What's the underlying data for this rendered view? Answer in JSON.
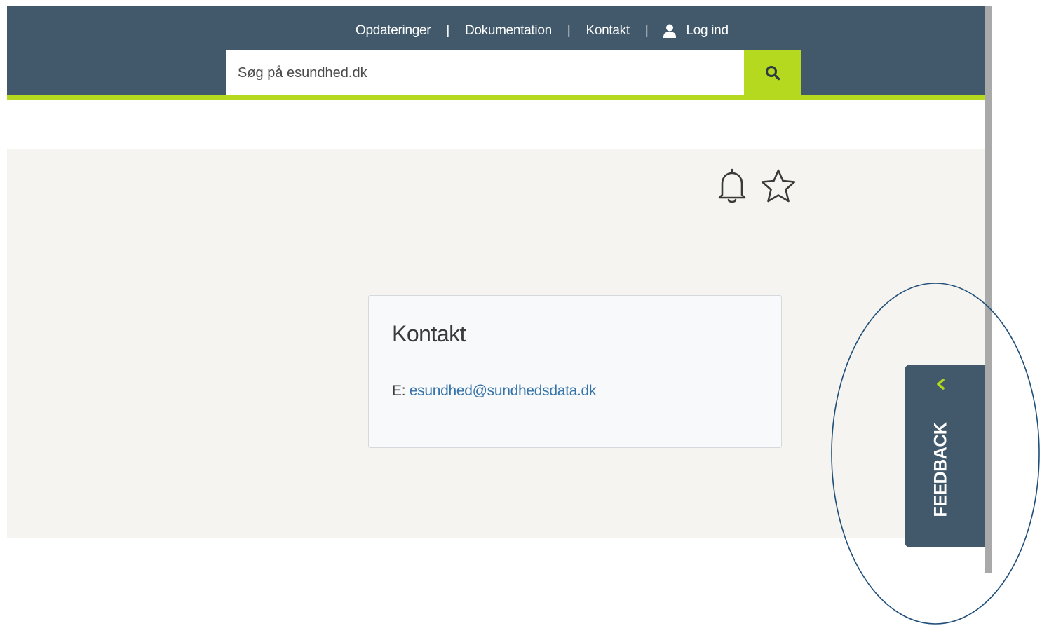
{
  "header": {
    "nav": [
      {
        "label": "Opdateringer"
      },
      {
        "label": "Dokumentation"
      },
      {
        "label": "Kontakt"
      }
    ],
    "separator": "|",
    "login_label": "Log ind",
    "login_icon": "user-icon",
    "search": {
      "placeholder": "Søg på esundhed.dk",
      "value": "",
      "icon": "search-icon"
    }
  },
  "actions": {
    "bell_icon": "bell-icon",
    "star_icon": "star-icon"
  },
  "contact_card": {
    "title": "Kontakt",
    "email_prefix": "E:",
    "email": "esundhed@sundhedsdata.dk"
  },
  "feedback": {
    "label": "FEEDBACK",
    "icon": "chevron-left-icon"
  },
  "colors": {
    "header_bg": "#41596b",
    "accent": "#b5d91e",
    "content_bg": "#f5f4f0",
    "link": "#3573a8",
    "annotation": "#1f4e79"
  }
}
